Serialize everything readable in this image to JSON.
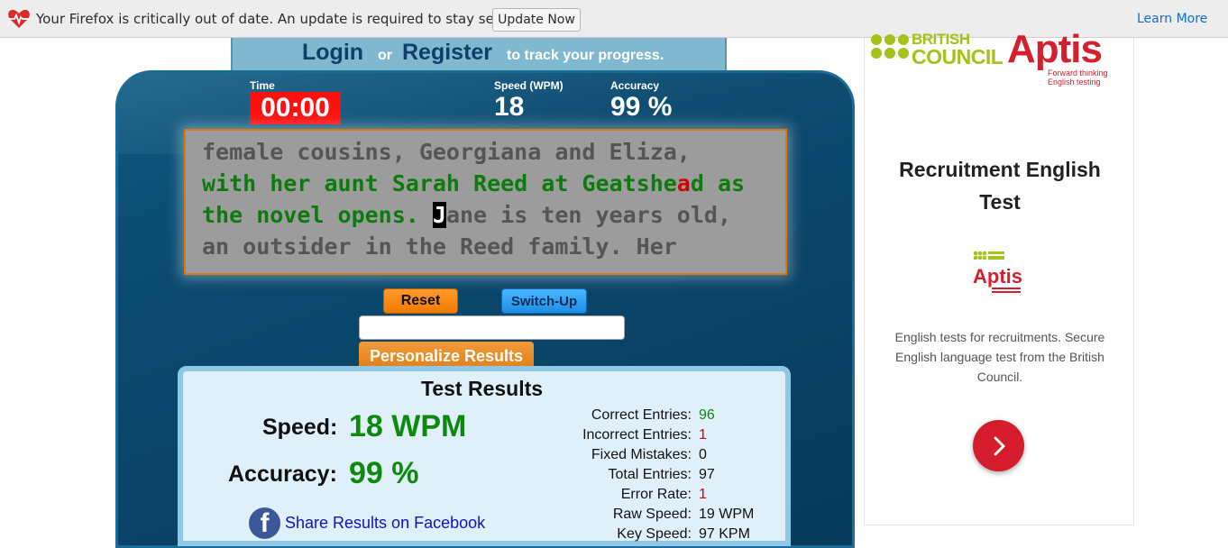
{
  "notification": {
    "message": "Your Firefox is critically out of date. An update is required to stay secure",
    "update_button": "Update Now",
    "learn_more": "Learn More",
    "icon": "heart-pulse-icon"
  },
  "login_strip": {
    "login": "Login",
    "or": "or",
    "register": "Register",
    "suffix": "to track your progress."
  },
  "stats": {
    "time_label": "Time",
    "time_value": "00:00",
    "speed_label": "Speed (WPM)",
    "speed_value": "18",
    "accuracy_label": "Accuracy",
    "accuracy_value": "99 %"
  },
  "typing_text": {
    "line1": "female cousins, Georgiana and Eliza,",
    "line2_typed": "with her aunt Sarah Reed at Geatshe",
    "line2_error": "a",
    "line2_rest": "d as",
    "line3_typed": "the novel opens. ",
    "line3_cursor": "J",
    "line3_rest": "ane is ten years old,",
    "line4": "an outsider in the Reed family. Her"
  },
  "controls": {
    "reset": "Reset",
    "switch_up": "Switch-Up",
    "input_value": "",
    "personalize": "Personalize Results"
  },
  "results": {
    "title": "Test Results",
    "speed_label": "Speed:",
    "speed_value": "18 WPM",
    "accuracy_label": "Accuracy:",
    "accuracy_value": "99 %",
    "share": "Share Results on Facebook",
    "details": [
      {
        "label": "Correct Entries:",
        "value": "96",
        "color": "green"
      },
      {
        "label": "Incorrect Entries:",
        "value": "1",
        "color": "red"
      },
      {
        "label": "Fixed Mistakes:",
        "value": "0",
        "color": ""
      },
      {
        "label": "Total Entries:",
        "value": "97",
        "color": ""
      },
      {
        "label": "Error Rate:",
        "value": "1",
        "color": "red"
      },
      {
        "label": "Raw Speed:",
        "value": "19 WPM",
        "color": ""
      },
      {
        "label": "Key Speed:",
        "value": "97 KPM",
        "color": ""
      }
    ]
  },
  "ad": {
    "brand_bc_line1": "BRITISH",
    "brand_bc_line2": "COUNCIL",
    "brand_aptis": "Aptis",
    "aptis_tag_line1": "Forward thinking",
    "aptis_tag_line2": "English testing",
    "title_line1": "Recruitment English",
    "title_line2": "Test",
    "description": "English tests for recruitments. Secure English language test from the British Council.",
    "go_icon": "chevron-right-icon"
  },
  "colors": {
    "panel": "#0b4a70",
    "timer": "#ff1010",
    "correct": "#0d7a0d",
    "error": "#d40000",
    "aptis_red": "#d4202d",
    "bc_green": "#a6c21a"
  }
}
